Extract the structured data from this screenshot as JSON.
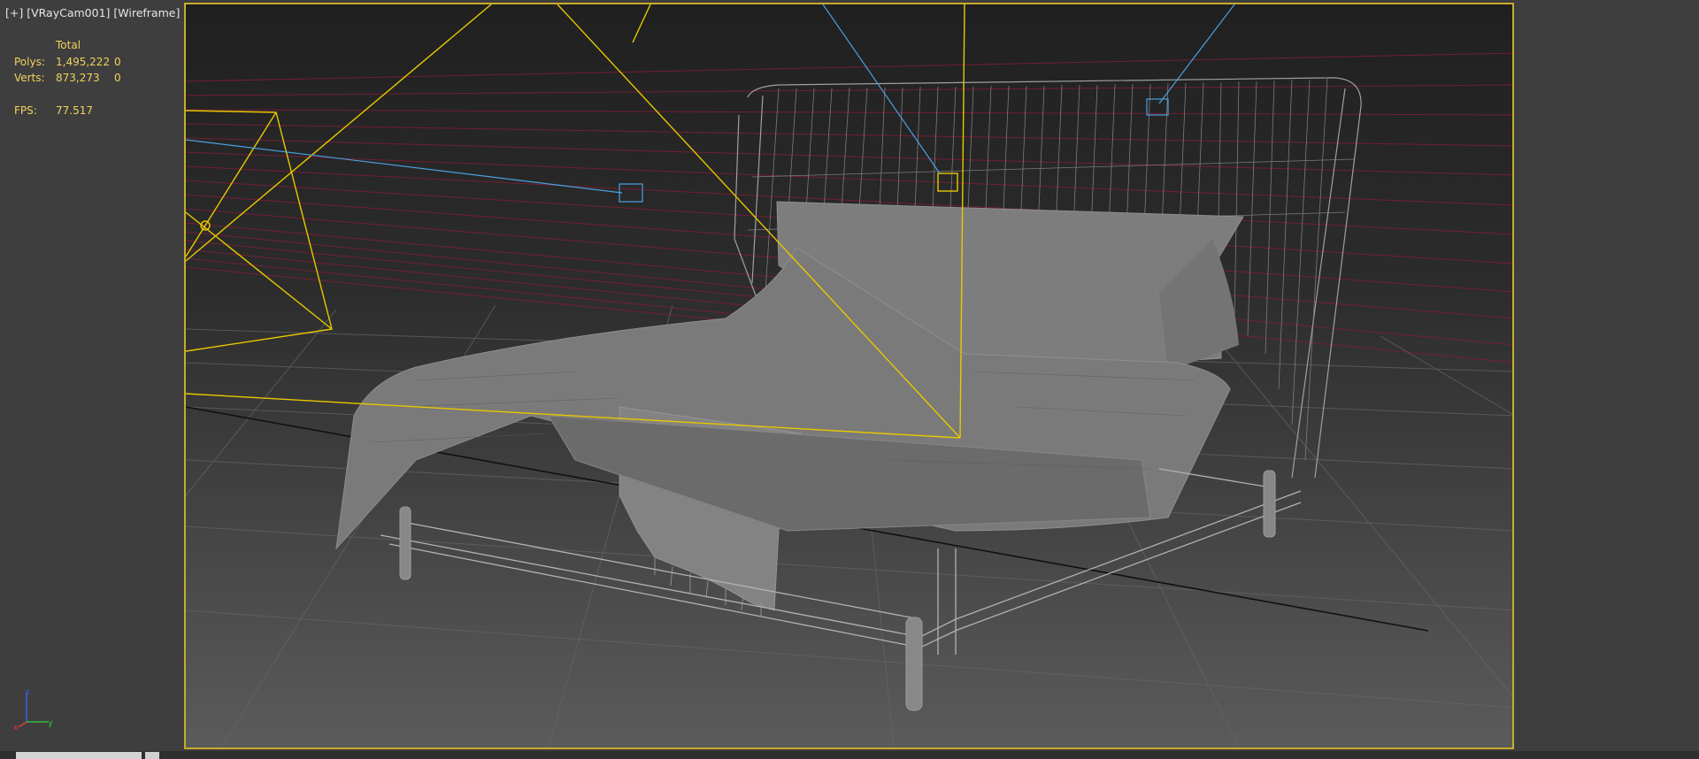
{
  "viewport": {
    "label_plus": "[+]",
    "label_camera": "[VRayCam001]",
    "label_mode": "[Wireframe]"
  },
  "stats": {
    "header": "Total",
    "polys_label": "Polys:",
    "polys_total": "1,495,222",
    "polys_selected": "0",
    "verts_label": "Verts:",
    "verts_total": "873,273",
    "verts_selected": "0",
    "fps_label": "FPS:",
    "fps_value": "77.517"
  },
  "axis_gizmo": {
    "x_label": "x",
    "y_label": "y",
    "z_label": "z"
  },
  "colors": {
    "viewport_bg_top": "#222222",
    "viewport_bg_bottom": "#5a5a5a",
    "border_active": "#c9ac2c",
    "camera_yellow": "#e8c800",
    "light_target_blue": "#4aa0e0",
    "wall_lines_red": "#7a1e36",
    "grid_gray": "#6a6a6a",
    "wire_gray": "#9a9a9a",
    "stats_yellow": "#f2d25c"
  }
}
